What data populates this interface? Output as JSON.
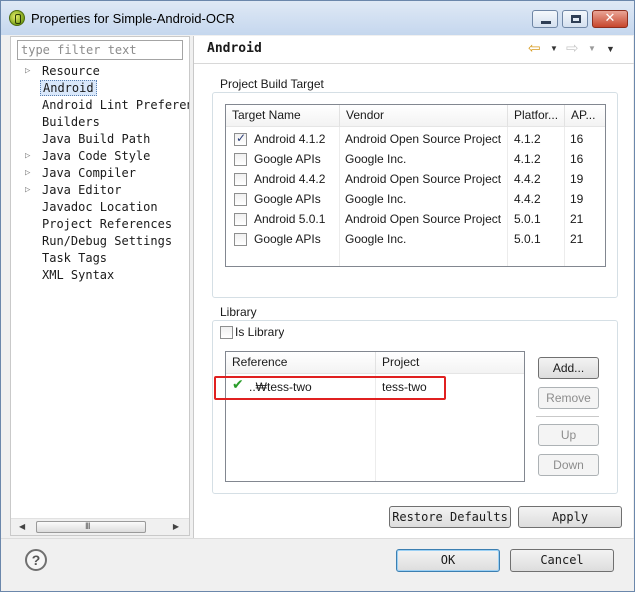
{
  "window": {
    "title": "Properties for Simple-Android-OCR",
    "close_glyph": "✕"
  },
  "sidebar": {
    "filter_placeholder": "type filter text",
    "items": [
      {
        "label": "Resource",
        "expandable": true
      },
      {
        "label": "Android",
        "expandable": false,
        "selected": true
      },
      {
        "label": "Android Lint Preferences",
        "expandable": false
      },
      {
        "label": "Builders",
        "expandable": false
      },
      {
        "label": "Java Build Path",
        "expandable": false
      },
      {
        "label": "Java Code Style",
        "expandable": true
      },
      {
        "label": "Java Compiler",
        "expandable": true
      },
      {
        "label": "Java Editor",
        "expandable": true
      },
      {
        "label": "Javadoc Location",
        "expandable": false
      },
      {
        "label": "Project References",
        "expandable": false
      },
      {
        "label": "Run/Debug Settings",
        "expandable": false
      },
      {
        "label": "Task Tags",
        "expandable": false
      },
      {
        "label": "XML Syntax",
        "expandable": false
      }
    ],
    "scroll_grip": "III"
  },
  "page": {
    "title": "Android"
  },
  "build_target": {
    "group_title": "Project Build Target",
    "columns": [
      "Target Name",
      "Vendor",
      "Platfor...",
      "AP..."
    ],
    "rows": [
      {
        "name": "Android 4.1.2",
        "vendor": "Android Open Source Project",
        "platform": "4.1.2",
        "api": "16",
        "checked": true
      },
      {
        "name": "Google APIs",
        "vendor": "Google Inc.",
        "platform": "4.1.2",
        "api": "16",
        "checked": false
      },
      {
        "name": "Android 4.4.2",
        "vendor": "Android Open Source Project",
        "platform": "4.4.2",
        "api": "19",
        "checked": false
      },
      {
        "name": "Google APIs",
        "vendor": "Google Inc.",
        "platform": "4.4.2",
        "api": "19",
        "checked": false
      },
      {
        "name": "Android 5.0.1",
        "vendor": "Android Open Source Project",
        "platform": "5.0.1",
        "api": "21",
        "checked": false
      },
      {
        "name": "Google APIs",
        "vendor": "Google Inc.",
        "platform": "5.0.1",
        "api": "21",
        "checked": false
      }
    ]
  },
  "library": {
    "group_title": "Library",
    "is_library_label": "Is Library",
    "is_library_checked": false,
    "columns": [
      "Reference",
      "Project"
    ],
    "rows": [
      {
        "reference": "..₩tess-two",
        "project": "tess-two",
        "status_icon": "check-icon",
        "status_glyph": "✔"
      }
    ],
    "buttons": {
      "add": "Add...",
      "remove": "Remove",
      "up": "Up",
      "down": "Down"
    }
  },
  "actions": {
    "restore_defaults": "Restore Defaults",
    "apply": "Apply",
    "ok": "OK",
    "cancel": "Cancel",
    "help": "?"
  },
  "colors": {
    "selection": "#d9e8fb",
    "highlight_border": "#e02020",
    "valid_check": "#2a9d2a"
  }
}
